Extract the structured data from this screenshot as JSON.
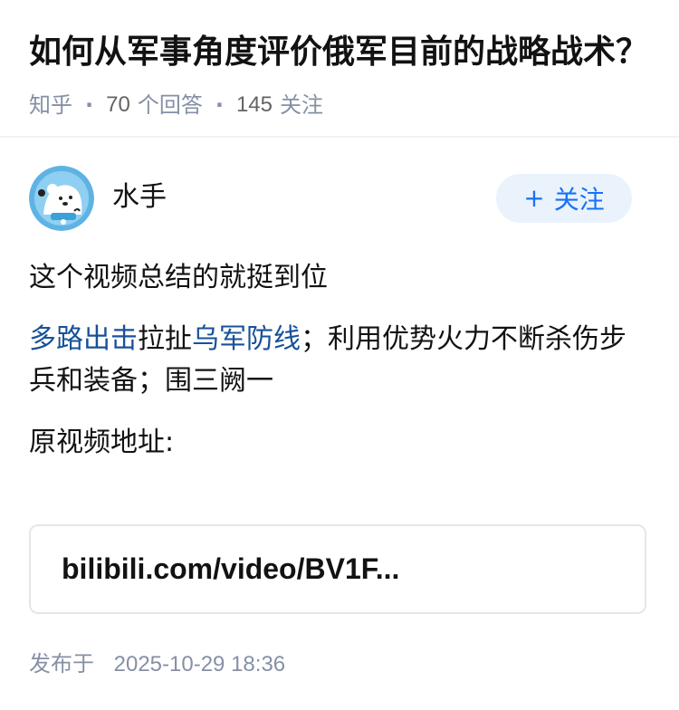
{
  "question": {
    "title": "如何从军事角度评价俄军目前的战略战术？",
    "source": "知乎",
    "answer_count": "70",
    "answer_count_label": "个回答",
    "follower_count": "145",
    "follower_count_label": "关注"
  },
  "author": {
    "name": "水手",
    "avatar_icon": "polar-bear-avatar",
    "follow_label": "关注"
  },
  "answer": {
    "paragraph1": "这个视频总结的就挺到位",
    "link1": "多路出击",
    "text1": "拉扯",
    "link2": "乌军防线",
    "text2": "；利用优势火力不断杀伤步兵和装备；围三阙一",
    "paragraph3": "原视频地址:",
    "link_card": "bilibili.com/video/BV1F..."
  },
  "footer": {
    "publish_label": "发布于",
    "publish_time": "2025-10-29 18:36"
  },
  "colors": {
    "link": "#175199",
    "follow_bg": "#eaf2fb",
    "follow_text": "#1772f6",
    "meta": "#8590a6"
  }
}
